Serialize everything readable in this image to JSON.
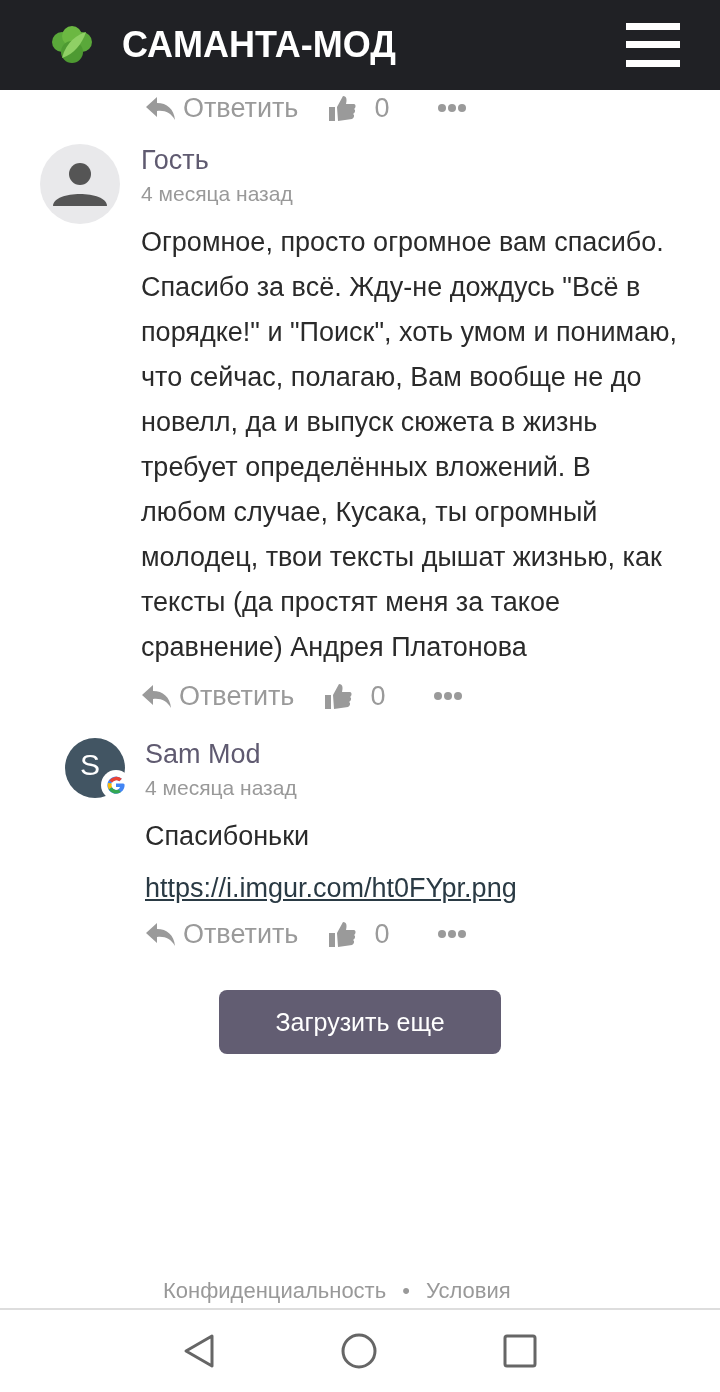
{
  "header": {
    "title": "САМАНТА-МОД"
  },
  "previous_actions": {
    "reply": "Ответить",
    "likes": "0"
  },
  "comments": [
    {
      "kind": "guest",
      "author": "Гость",
      "time": "4 месяца назад",
      "text": "Огромное, просто огромное вам спасибо. Спасибо за всё. Жду-не дождусь \"Всё в порядке!\" и \"Поиск\", хоть умом и понимаю, что сейчас, полагаю, Вам вообще не до новелл, да и выпуск сюжета в жизнь требует определённых вложений. В любом случае, Кусака, ты огромный молодец, твои тексты дышат жизнью, как тексты (да простят меня за такое сравнение) Андрея Платонова",
      "reply": "Ответить",
      "likes": "0",
      "children": [
        {
          "kind": "google",
          "initial": "S",
          "author": "Sam Mod",
          "time": "4 месяца назад",
          "text": "Спасибоньки",
          "link": "https://i.imgur.com/ht0FYpr.png",
          "reply": "Ответить",
          "likes": "0"
        }
      ]
    }
  ],
  "load_more": "Загрузить еще",
  "footer": {
    "links": [
      "Конфиденциальность",
      "Условия"
    ],
    "separator": "•"
  }
}
